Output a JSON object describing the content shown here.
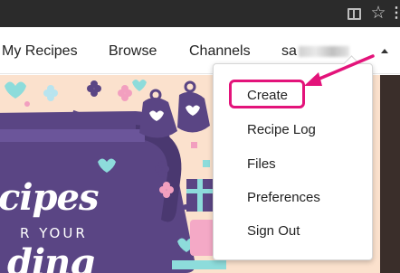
{
  "nav": {
    "my_recipes": "My Recipes",
    "browse": "Browse",
    "channels": "Channels",
    "user_prefix": "sa"
  },
  "dropdown": {
    "items": [
      "Create",
      "Recipe Log",
      "Files",
      "Preferences",
      "Sign Out"
    ]
  },
  "hero": {
    "line1": "cipes",
    "line2": "R YOUR",
    "line3": "ding"
  },
  "icons": {
    "reader": "reader-view-icon",
    "star": "bookmark-star-icon",
    "menu": "more-menu-icon",
    "caret": "caret-up-icon",
    "arrow": "annotation-arrow"
  },
  "colors": {
    "annotation": "#e3137a",
    "hero_background": "#fbe1cd",
    "hero_purple": "#5a4584"
  }
}
